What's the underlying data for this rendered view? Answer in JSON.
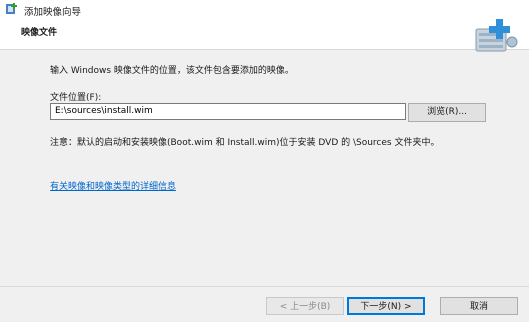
{
  "window": {
    "title": "添加映像向导"
  },
  "header": {
    "title": "映像文件"
  },
  "main": {
    "instruction": "输入 Windows 映像文件的位置，该文件包含要添加的映像。",
    "location_label": "文件位置(F):",
    "location_value": "E:\\sources\\install.wim",
    "browse_label": "浏览(R)...",
    "note": "注意：默认的启动和安装映像(Boot.wim 和 Install.wim)位于安装 DVD 的 \\Sources 文件夹中。",
    "more_info_link": "有关映像和映像类型的详细信息"
  },
  "footer": {
    "back_label": "< 上一步(B)",
    "next_label": "下一步(N) >",
    "cancel_label": "取消"
  }
}
